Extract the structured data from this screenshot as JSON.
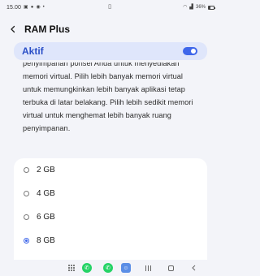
{
  "status_bar": {
    "time": "15.00",
    "left_icons": [
      "image-icon",
      "message-icon",
      "chat-icon",
      "dot-icon"
    ],
    "center_icon": "lock-icon",
    "right_icons": [
      "wifi-icon",
      "signal-icon"
    ],
    "battery_percent": "36%",
    "battery_level": 0.36
  },
  "header": {
    "back_icon": "back-arrow-icon",
    "title": "RAM Plus"
  },
  "toggle_card": {
    "label": "Aktif",
    "state": true
  },
  "description": {
    "text": "penyimpanan ponsel Anda untuk menyediakan memori virtual. Pilih lebih banyak memori virtual untuk memungkinkan lebih banyak aplikasi tetap terbuka di latar belakang. Pilih lebih sedikit memori virtual untuk menghemat lebih banyak ruang penyimpanan."
  },
  "options": [
    {
      "label": "2 GB",
      "selected": false
    },
    {
      "label": "4 GB",
      "selected": false
    },
    {
      "label": "6 GB",
      "selected": false
    },
    {
      "label": "8 GB",
      "selected": true
    }
  ],
  "nav_bar": {
    "items": [
      "apps-grid-icon",
      "whatsapp-icon",
      "whatsapp-icon",
      "app-icon",
      "recent-apps-icon",
      "home-icon",
      "back-icon"
    ]
  },
  "colors": {
    "accent": "#3f67ea",
    "toggle_card_bg": "#dfe6fb",
    "page_bg": "#f3f4f9",
    "whatsapp": "#25d366"
  }
}
